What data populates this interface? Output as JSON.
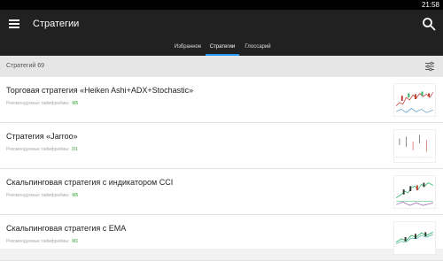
{
  "status_bar": {
    "time": "21:58"
  },
  "app_bar": {
    "title": "Стратегии",
    "menu_icon": "hamburger-menu-icon",
    "search_icon": "search-icon"
  },
  "tabs": [
    {
      "label": "Избранное",
      "active": false
    },
    {
      "label": "Стратегии",
      "active": true
    },
    {
      "label": "Глоссарий",
      "active": false
    }
  ],
  "list_header": {
    "count_label": "Стратегий 69",
    "filter_icon": "filter-sliders-icon"
  },
  "strategies": [
    {
      "name": "Торговая стратегия «Heiken Ashi+ADX+Stochastic»",
      "timeframes_label": "Рекомендуемые таймфреймы:",
      "timeframe": "M5"
    },
    {
      "name": "Стратегия «Jarroo»",
      "timeframes_label": "Рекомендуемые таймфреймы:",
      "timeframe": "D1"
    },
    {
      "name": "Скальпинговая стратегия с индикатором CCI",
      "timeframes_label": "Рекомендуемые таймфреймы:",
      "timeframe": "M5"
    },
    {
      "name": "Скальпинговая стратегия с EMA",
      "timeframes_label": "Рекомендуемые таймфреймы:",
      "timeframe": "M1"
    }
  ],
  "colors": {
    "app_bar": "#212121",
    "tab_indicator": "#2196f3",
    "timeframe": "#2e9e2e"
  }
}
